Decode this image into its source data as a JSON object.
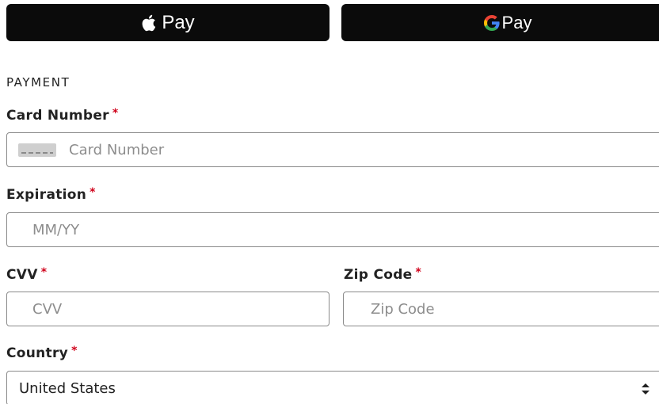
{
  "payment_buttons": {
    "apple": {
      "label": "Pay",
      "icon": "apple-icon"
    },
    "google": {
      "label": "Pay",
      "icon": "google-g-icon"
    }
  },
  "section": {
    "title": "PAYMENT"
  },
  "fields": {
    "card_number": {
      "label": "Card Number",
      "required": "*",
      "placeholder": "Card Number",
      "value": ""
    },
    "expiration": {
      "label": "Expiration",
      "required": "*",
      "placeholder": "MM/YY",
      "value": ""
    },
    "cvv": {
      "label": "CVV",
      "required": "*",
      "placeholder": "CVV",
      "value": ""
    },
    "zip": {
      "label": "Zip Code",
      "required": "*",
      "placeholder": "Zip Code",
      "value": ""
    },
    "country": {
      "label": "Country",
      "required": "*",
      "selected": "United States"
    }
  },
  "colors": {
    "button_bg": "#0b0b0b",
    "required": "#d0021b",
    "border": "#8a8a8a"
  }
}
